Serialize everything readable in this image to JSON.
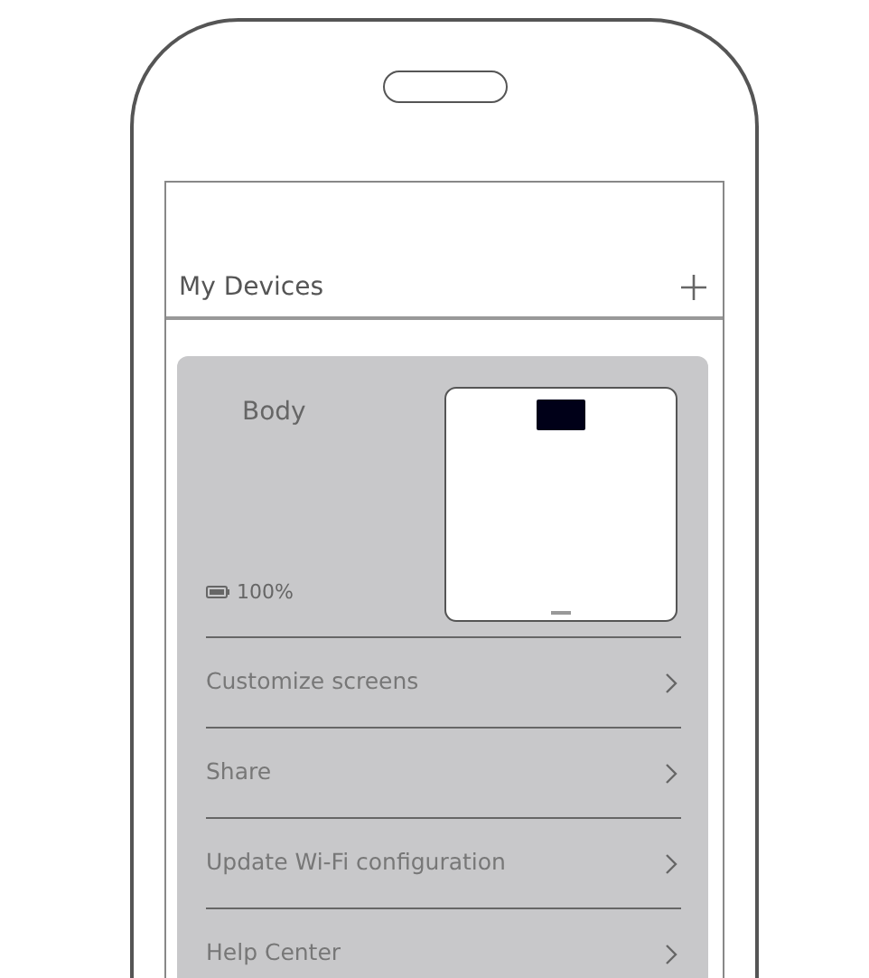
{
  "header": {
    "title": "My Devices"
  },
  "device": {
    "name": "Body",
    "battery": "100%",
    "menu": [
      {
        "label": "Customize screens"
      },
      {
        "label": "Share"
      },
      {
        "label": "Update Wi-Fi configuration"
      },
      {
        "label": "Help Center"
      }
    ]
  }
}
